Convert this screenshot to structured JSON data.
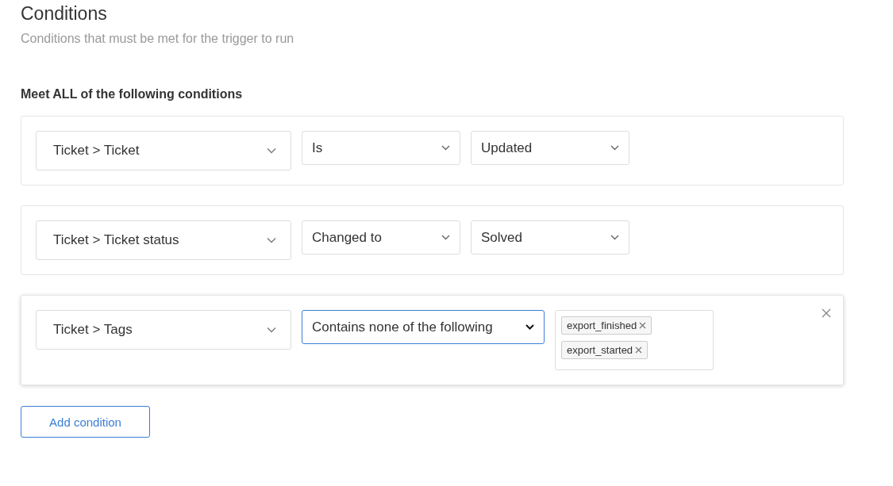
{
  "header": {
    "title": "Conditions",
    "subtitle": "Conditions that must be met for the trigger to run"
  },
  "group": {
    "heading": "Meet ALL of the following conditions"
  },
  "conditions": [
    {
      "active": false,
      "field": "Ticket > Ticket",
      "operator": {
        "label": "Is",
        "focused": false
      },
      "value": {
        "kind": "select",
        "label": "Updated"
      }
    },
    {
      "active": false,
      "field": "Ticket > Ticket status",
      "operator": {
        "label": "Changed to",
        "focused": false
      },
      "value": {
        "kind": "select",
        "label": "Solved"
      }
    },
    {
      "active": true,
      "field": "Ticket > Tags",
      "operator": {
        "label": "Contains none of the following",
        "focused": true
      },
      "value": {
        "kind": "tags",
        "tags": [
          "export_finished",
          "export_started"
        ]
      }
    }
  ],
  "add_button": "Add condition"
}
